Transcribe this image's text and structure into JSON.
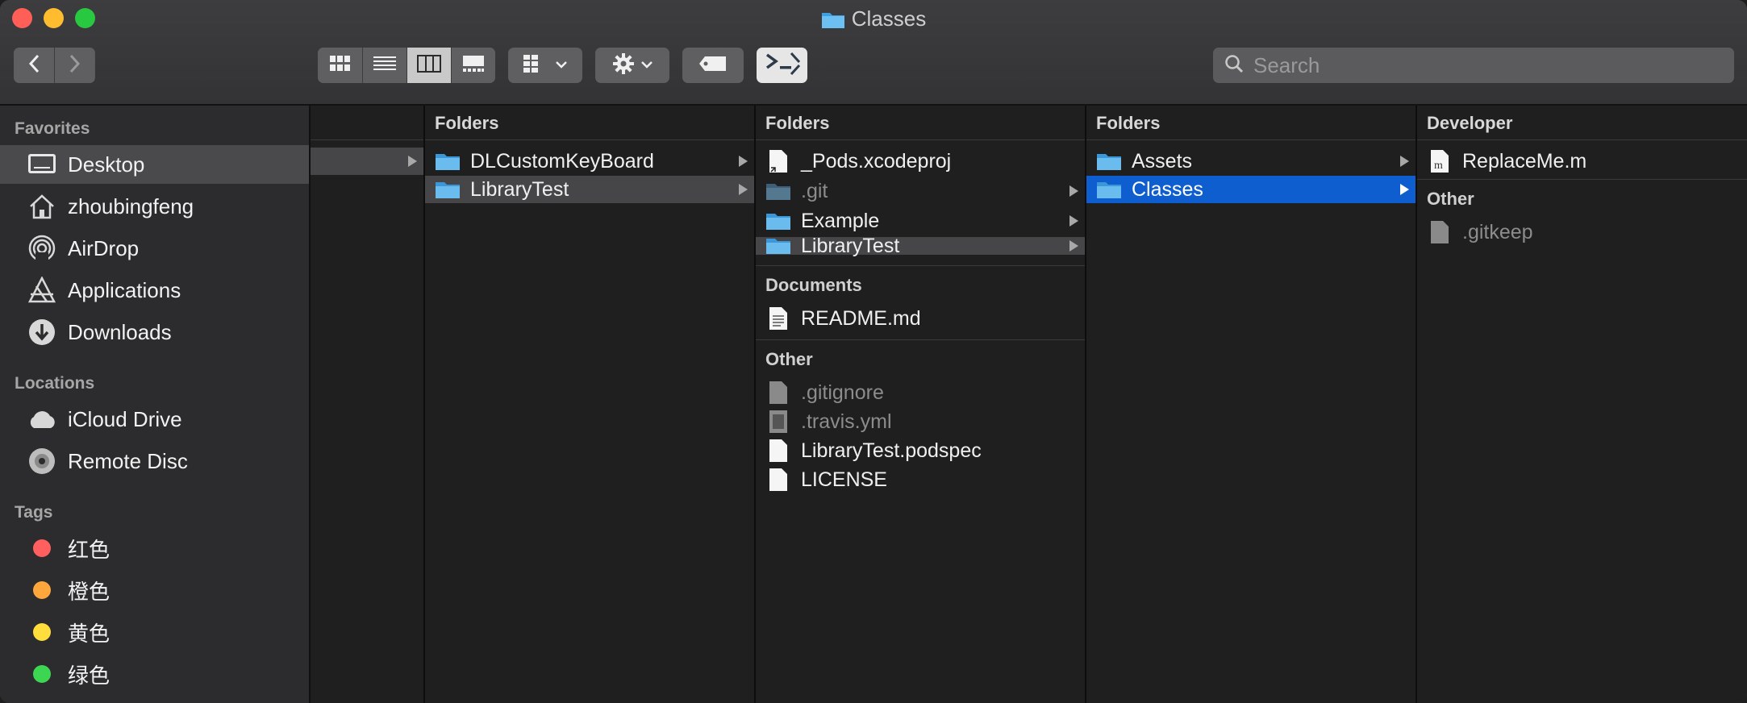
{
  "window": {
    "title": "Classes"
  },
  "toolbar": {
    "search_placeholder": "Search"
  },
  "sidebar": {
    "favorites_header": "Favorites",
    "favorites": [
      {
        "label": "Desktop",
        "icon": "desktop-icon",
        "selected": true
      },
      {
        "label": "zhoubingfeng",
        "icon": "home-icon"
      },
      {
        "label": "AirDrop",
        "icon": "airdrop-icon"
      },
      {
        "label": "Applications",
        "icon": "applications-icon"
      },
      {
        "label": "Downloads",
        "icon": "downloads-icon"
      }
    ],
    "locations_header": "Locations",
    "locations": [
      {
        "label": "iCloud Drive",
        "icon": "cloud-icon"
      },
      {
        "label": "Remote Disc",
        "icon": "disc-icon"
      }
    ],
    "tags_header": "Tags",
    "tags": [
      {
        "label": "红色",
        "color": "#ff5f5f"
      },
      {
        "label": "橙色",
        "color": "#ffa63d"
      },
      {
        "label": "黄色",
        "color": "#ffdd3d"
      },
      {
        "label": "绿色",
        "color": "#3dd653"
      }
    ]
  },
  "columns": {
    "col2": {
      "header": "Folders",
      "items": [
        "DLCustomKeyBoard",
        "LibraryTest"
      ]
    },
    "col3": {
      "header": "Folders",
      "folders": [
        "_Pods.xcodeproj",
        ".git",
        "Example",
        "LibraryTest"
      ],
      "documents_header": "Documents",
      "documents": [
        "README.md"
      ],
      "other_header": "Other",
      "other": [
        ".gitignore",
        ".travis.yml",
        "LibraryTest.podspec",
        "LICENSE"
      ]
    },
    "col4": {
      "header": "Folders",
      "items": [
        "Assets",
        "Classes"
      ]
    },
    "col5": {
      "header": "Developer",
      "developer": [
        "ReplaceMe.m"
      ],
      "other_header": "Other",
      "other": [
        ".gitkeep"
      ]
    }
  },
  "colors": {
    "selection_blue": "#0f5ecf",
    "selection_gray": "#464648"
  }
}
